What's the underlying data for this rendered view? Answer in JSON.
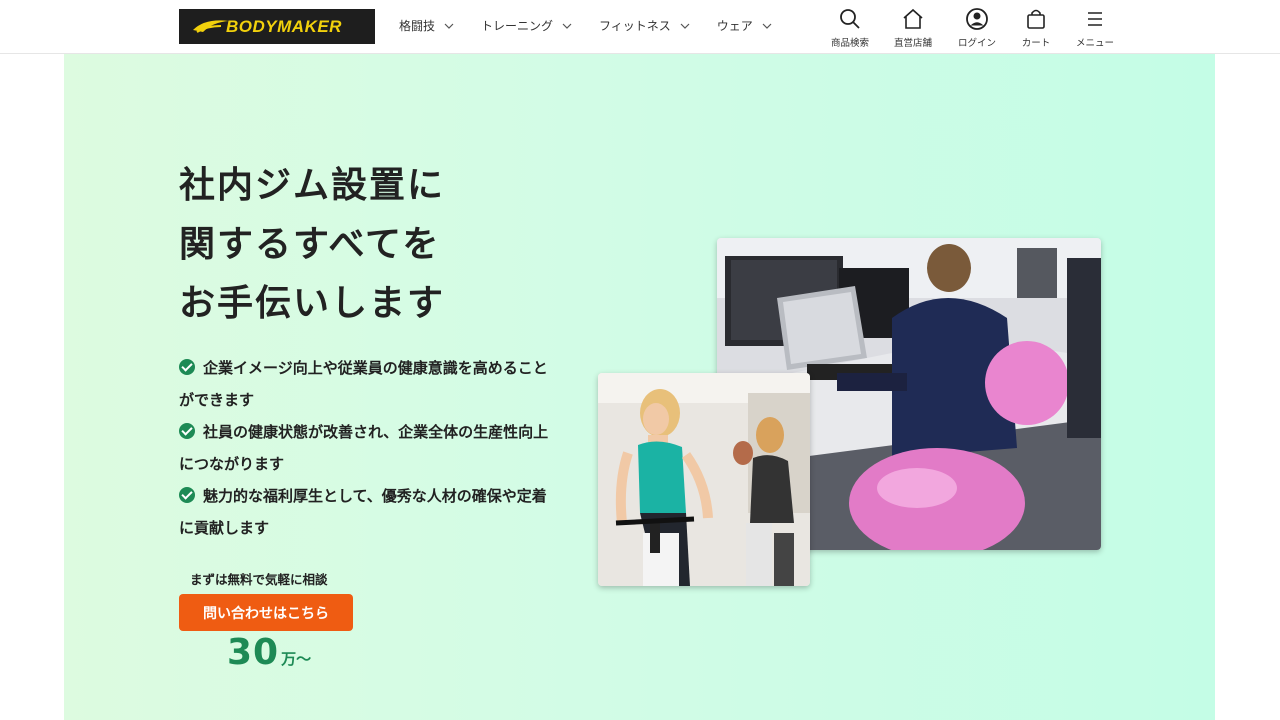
{
  "header": {
    "logo_text": "BODYMAKER",
    "nav": [
      {
        "label": "格闘技"
      },
      {
        "label": "トレーニング"
      },
      {
        "label": "フィットネス"
      },
      {
        "label": "ウェア"
      }
    ],
    "tools": {
      "search": "商品検索",
      "store": "直営店舗",
      "login": "ログイン",
      "cart": "カート",
      "menu": "メニュー"
    }
  },
  "hero": {
    "headline": [
      "社内ジム設置に",
      "関するすべてを",
      "お手伝いします"
    ],
    "points": [
      "企業イメージ向上や従業員の健康意識を高めることができます",
      "社員の健康状態が改善され、企業全体の生産性向上につながります",
      "魅力的な福利厚生として、優秀な人材の確保や定着に貢献します"
    ],
    "cta_note": "まずは無料で気軽に相談",
    "cta_button": "問い合わせはこちら",
    "price_number": "30",
    "price_unit": "万～"
  },
  "colors": {
    "brand_yellow": "#f2d10c",
    "accent_green": "#1d8a55",
    "cta_orange": "#ef5c12",
    "hero_bg": "#d2fce6"
  },
  "icons": [
    "search-icon",
    "home-icon",
    "user-icon",
    "bag-icon",
    "menu-icon",
    "chevron-down-icon",
    "check-circle-icon"
  ]
}
